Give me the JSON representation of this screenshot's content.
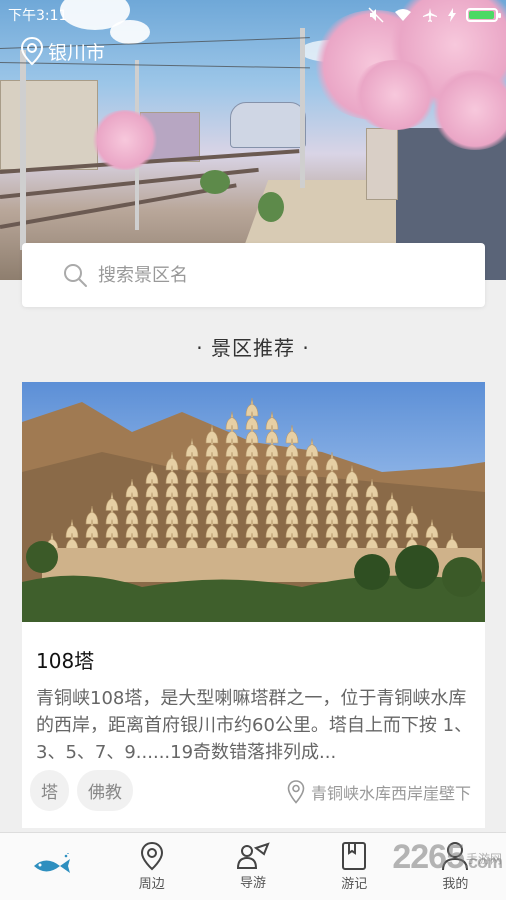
{
  "status_bar": {
    "time": "下午3:11",
    "icons": [
      "mute-icon",
      "wifi-icon",
      "airplane-icon",
      "charging-icon",
      "battery-icon"
    ],
    "battery_level": 0.95,
    "battery_color": "#4cd964"
  },
  "header": {
    "location": "银川市",
    "location_icon": "location-pin-icon"
  },
  "search": {
    "placeholder": "搜索景区名",
    "icon": "search-icon"
  },
  "section": {
    "title": "· 景区推荐 ·"
  },
  "card": {
    "title": "108塔",
    "description": "青铜峡108塔，是大型喇嘛塔群之一，位于青铜峡水库的西岸，距离首府银川市约60公里。塔自上而下按 1、3、5、7、9......19奇数错落排列成...",
    "tags": [
      "塔",
      "佛教"
    ],
    "location": "青铜峡水库西岸崖壁下",
    "location_icon": "location-pin-icon"
  },
  "bottom_nav": {
    "items": [
      {
        "label": "",
        "icon": "fish-icon"
      },
      {
        "label": "周边",
        "icon": "location-pin-icon"
      },
      {
        "label": "导游",
        "icon": "guide-icon"
      },
      {
        "label": "游记",
        "icon": "notebook-icon"
      },
      {
        "label": "我的",
        "icon": "person-icon"
      }
    ],
    "active_color": "#2e8fbf"
  },
  "watermark": {
    "main": "2265",
    "sub": ".com",
    "label": "手游网"
  }
}
